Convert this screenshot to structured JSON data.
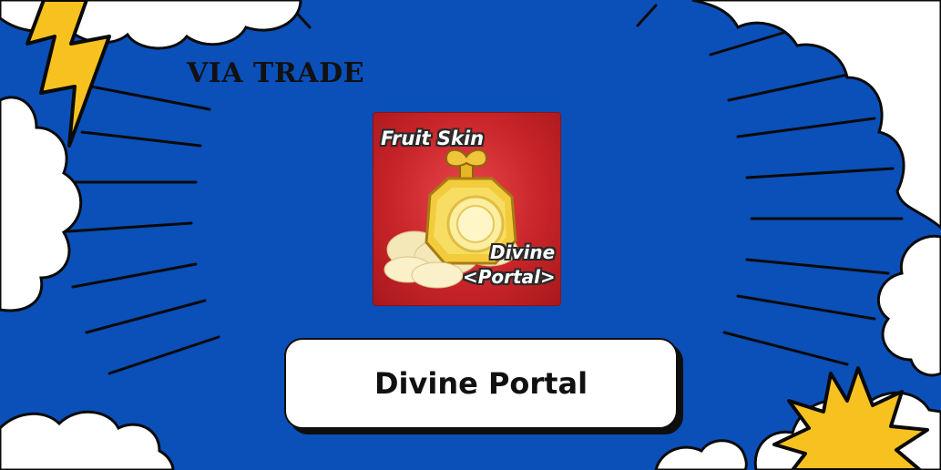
{
  "banner": {
    "headline": "VIA TRADE",
    "background_color": "#0b4fb8",
    "accent_color": "#f7c21f",
    "icons": [
      "lightning-bolt-icon",
      "starburst-icon"
    ]
  },
  "item_card": {
    "title": "Fruit Skin",
    "name_line1": "Divine",
    "name_line2": "<Portal>",
    "card_color": "#c9252a",
    "image_icon": "gold-fruit-icon"
  },
  "item_name": "Divine Portal"
}
